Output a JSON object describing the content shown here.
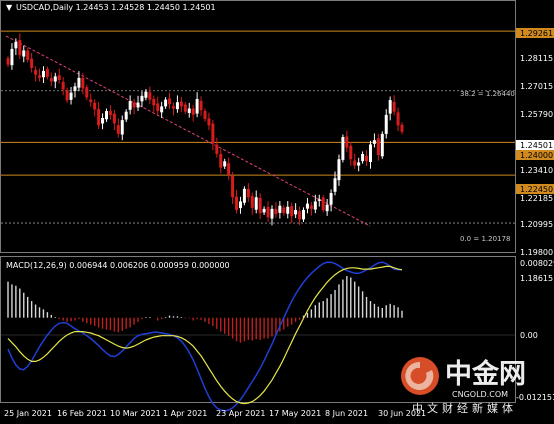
{
  "main": {
    "symbol_menu_glyph": "▼",
    "header": "USDCAD,Daily  1.24453 1.24528 1.24450 1.24501",
    "price_ticks": [
      "1.29261",
      "1.28115",
      "1.27015",
      "1.25790",
      "1.24501",
      "1.23410",
      "1.22185",
      "1.20995",
      "1.19800",
      "1.18615"
    ],
    "highlighted_ticks": [
      "1.29261",
      "1.24000",
      "1.22450"
    ],
    "current_price": "1.24501",
    "fib_note": "38.2 = 1.26440",
    "fib_note2": "0.0 = 1.20178",
    "levels": [
      {
        "value": 1.2926,
        "label": "1.29261",
        "color": "#d08a1e"
      },
      {
        "value": 1.24,
        "label": "1.24000",
        "color": "#d08a1e"
      },
      {
        "value": 1.2245,
        "label": "1.22450",
        "color": "#d08a1e"
      }
    ],
    "fib_levels": [
      1.2644,
      1.20178
    ]
  },
  "macd": {
    "header": "MACD(12,26,9) 0.006944 0.006206 0.000959 0.000000",
    "ticks": [
      "0.008029",
      "0.00",
      "-0.012151"
    ]
  },
  "date_axis": [
    "25 Jan 2021",
    "16 Feb 2021",
    "10 Mar 2021",
    "1 Apr 2021",
    "23 Apr 2021",
    "17 May 2021",
    "8 Jun 2021",
    "30 Jun 2021"
  ],
  "watermark": {
    "brand": "中金网",
    "url": "CNGOLD.COM",
    "slogan": "中文财经新媒体"
  },
  "chart_data": {
    "type": "candlestick",
    "symbol": "USDCAD",
    "timeframe": "Daily",
    "last_ohlc": {
      "open": 1.24453,
      "high": 1.24528,
      "low": 1.2445,
      "close": 1.24501
    },
    "price_range": [
      1.1862,
      1.296
    ],
    "x_labels": [
      "25 Jan 2021",
      "16 Feb 2021",
      "10 Mar 2021",
      "1 Apr 2021",
      "23 Apr 2021",
      "17 May 2021",
      "8 Jun 2021",
      "30 Jun 2021"
    ],
    "closes": [
      1.2768,
      1.2842,
      1.2875,
      1.2812,
      1.2835,
      1.279,
      1.2752,
      1.272,
      1.2705,
      1.2738,
      1.271,
      1.2688,
      1.2712,
      1.2695,
      1.265,
      1.2598,
      1.2635,
      1.2665,
      1.2705,
      1.2655,
      1.2612,
      1.259,
      1.2555,
      1.248,
      1.2515,
      1.2548,
      1.253,
      1.249,
      1.244,
      1.2505,
      1.2545,
      1.2595,
      1.2565,
      1.2588,
      1.262,
      1.264,
      1.2602,
      1.2575,
      1.2548,
      1.257,
      1.2602,
      1.258,
      1.256,
      1.259,
      1.257,
      1.2545,
      1.256,
      1.253,
      1.2605,
      1.2552,
      1.251,
      1.248,
      1.2395,
      1.2345,
      1.228,
      1.231,
      1.2245,
      1.214,
      1.208,
      1.212,
      1.218,
      1.214,
      1.209,
      1.214,
      1.2065,
      1.2085,
      1.2045,
      1.2085,
      1.206,
      1.21,
      1.2065,
      1.2095,
      1.205,
      1.208,
      1.2035,
      1.208,
      1.211,
      1.2085,
      1.212,
      1.213,
      1.208,
      1.2105,
      1.216,
      1.223,
      1.232,
      1.2425,
      1.2375,
      1.232,
      1.229,
      1.2305,
      1.2345,
      1.231,
      1.239,
      1.241,
      1.234,
      1.244,
      1.253,
      1.26,
      1.2545,
      1.248,
      1.245
    ],
    "macd_histogram": [
      0.0052,
      0.0048,
      0.0046,
      0.0042,
      0.0036,
      0.003,
      0.0024,
      0.0019,
      0.0015,
      0.0012,
      0.0008,
      0.0004,
      0.0001,
      -0.0002,
      -0.0004,
      -0.0006,
      -0.0005,
      -0.0004,
      -0.0002,
      -0.0006,
      -0.0008,
      -0.001,
      -0.0012,
      -0.0014,
      -0.0016,
      -0.0017,
      -0.0018,
      -0.002,
      -0.0021,
      -0.0019,
      -0.0016,
      -0.0014,
      -0.001,
      -0.0006,
      -0.0002,
      0.0001,
      0.0001,
      0.0,
      -0.0004,
      -0.0002,
      0.0001,
      0.0003,
      0.0002,
      0.0002,
      0.0001,
      -0.0001,
      -0.0001,
      -0.0004,
      -0.0002,
      -0.0003,
      -0.0006,
      -0.0009,
      -0.0012,
      -0.0016,
      -0.002,
      -0.0023,
      -0.0026,
      -0.003,
      -0.0034,
      -0.0036,
      -0.0034,
      -0.0032,
      -0.0033,
      -0.0031,
      -0.0032,
      -0.003,
      -0.003,
      -0.0027,
      -0.0025,
      -0.002,
      -0.0017,
      -0.0013,
      -0.001,
      -0.0006,
      -0.0003,
      0.0003,
      0.0007,
      0.0012,
      0.0018,
      0.0022,
      0.0024,
      0.0028,
      0.0034,
      0.004,
      0.0048,
      0.0055,
      0.006,
      0.0058,
      0.0052,
      0.0045,
      0.0038,
      0.003,
      0.0024,
      0.002,
      0.0016,
      0.0014,
      0.0018,
      0.002,
      0.0018,
      0.0015,
      0.001
    ],
    "macd_line": [
      -0.0045,
      -0.0058,
      -0.0068,
      -0.0074,
      -0.0075,
      -0.007,
      -0.0062,
      -0.0052,
      -0.0042,
      -0.0033,
      -0.0025,
      -0.0018,
      -0.0012,
      -0.0008,
      -0.0007,
      -0.0008,
      -0.0012,
      -0.0016,
      -0.0019,
      -0.0022,
      -0.0026,
      -0.003,
      -0.0035,
      -0.004,
      -0.0046,
      -0.0051,
      -0.0055,
      -0.0056,
      -0.0053,
      -0.0048,
      -0.0042,
      -0.0036,
      -0.003,
      -0.0026,
      -0.0024,
      -0.0023,
      -0.0022,
      -0.0021,
      -0.0021,
      -0.0022,
      -0.0023,
      -0.0024,
      -0.0026,
      -0.0029,
      -0.0034,
      -0.0041,
      -0.005,
      -0.0061,
      -0.0074,
      -0.0088,
      -0.0102,
      -0.0114,
      -0.0124,
      -0.013,
      -0.0133,
      -0.0134,
      -0.0133,
      -0.013,
      -0.0125,
      -0.0118,
      -0.011,
      -0.0101,
      -0.0092,
      -0.0083,
      -0.0073,
      -0.0062,
      -0.005,
      -0.0038,
      -0.0025,
      -0.0012,
      0.0,
      0.0012,
      0.0024,
      0.0034,
      0.0043,
      0.0051,
      0.0058,
      0.0064,
      0.0069,
      0.0074,
      0.0078,
      0.008,
      0.008,
      0.0078,
      0.0075,
      0.0071,
      0.0068,
      0.0066,
      0.0064,
      0.0064,
      0.0066,
      0.0069,
      0.0072,
      0.0076,
      0.0079,
      0.008,
      0.0078,
      0.0074,
      0.007,
      0.0069,
      0.0069
    ],
    "signal_line": [
      -0.003,
      -0.0036,
      -0.0042,
      -0.0049,
      -0.0055,
      -0.006,
      -0.0063,
      -0.0063,
      -0.0061,
      -0.0057,
      -0.0052,
      -0.0046,
      -0.004,
      -0.0034,
      -0.0029,
      -0.0025,
      -0.0022,
      -0.002,
      -0.002,
      -0.002,
      -0.0021,
      -0.0022,
      -0.0024,
      -0.0026,
      -0.0029,
      -0.0032,
      -0.0035,
      -0.0038,
      -0.0041,
      -0.0043,
      -0.0044,
      -0.0043,
      -0.0041,
      -0.0038,
      -0.0035,
      -0.0032,
      -0.003,
      -0.0028,
      -0.0027,
      -0.0026,
      -0.0026,
      -0.0026,
      -0.0026,
      -0.0027,
      -0.0029,
      -0.0032,
      -0.0036,
      -0.0041,
      -0.0048,
      -0.0055,
      -0.0064,
      -0.0073,
      -0.0082,
      -0.0091,
      -0.0099,
      -0.0106,
      -0.0112,
      -0.0117,
      -0.0121,
      -0.0123,
      -0.0124,
      -0.0123,
      -0.0121,
      -0.0117,
      -0.0112,
      -0.0106,
      -0.0098,
      -0.009,
      -0.008,
      -0.007,
      -0.0059,
      -0.0047,
      -0.0035,
      -0.0023,
      -0.0012,
      -0.0001,
      0.001,
      0.002,
      0.0029,
      0.0037,
      0.0044,
      0.0051,
      0.0057,
      0.0062,
      0.0066,
      0.0069,
      0.0071,
      0.0072,
      0.0072,
      0.0071,
      0.007,
      0.007,
      0.007,
      0.0071,
      0.0072,
      0.0073,
      0.0074,
      0.0074,
      0.0072,
      0.007,
      0.0069
    ],
    "macd_range": [
      -0.012151,
      0.008029
    ],
    "colors": {
      "bull": "#ffffff",
      "bear": "#d81b1b",
      "level": "#d08a1e",
      "trend": "#e0407a",
      "macd_line": "#1f3fd6",
      "signal": "#e8e84a",
      "hist_pos": "#d8d8d8",
      "hist_neg": "#c0201c"
    }
  }
}
